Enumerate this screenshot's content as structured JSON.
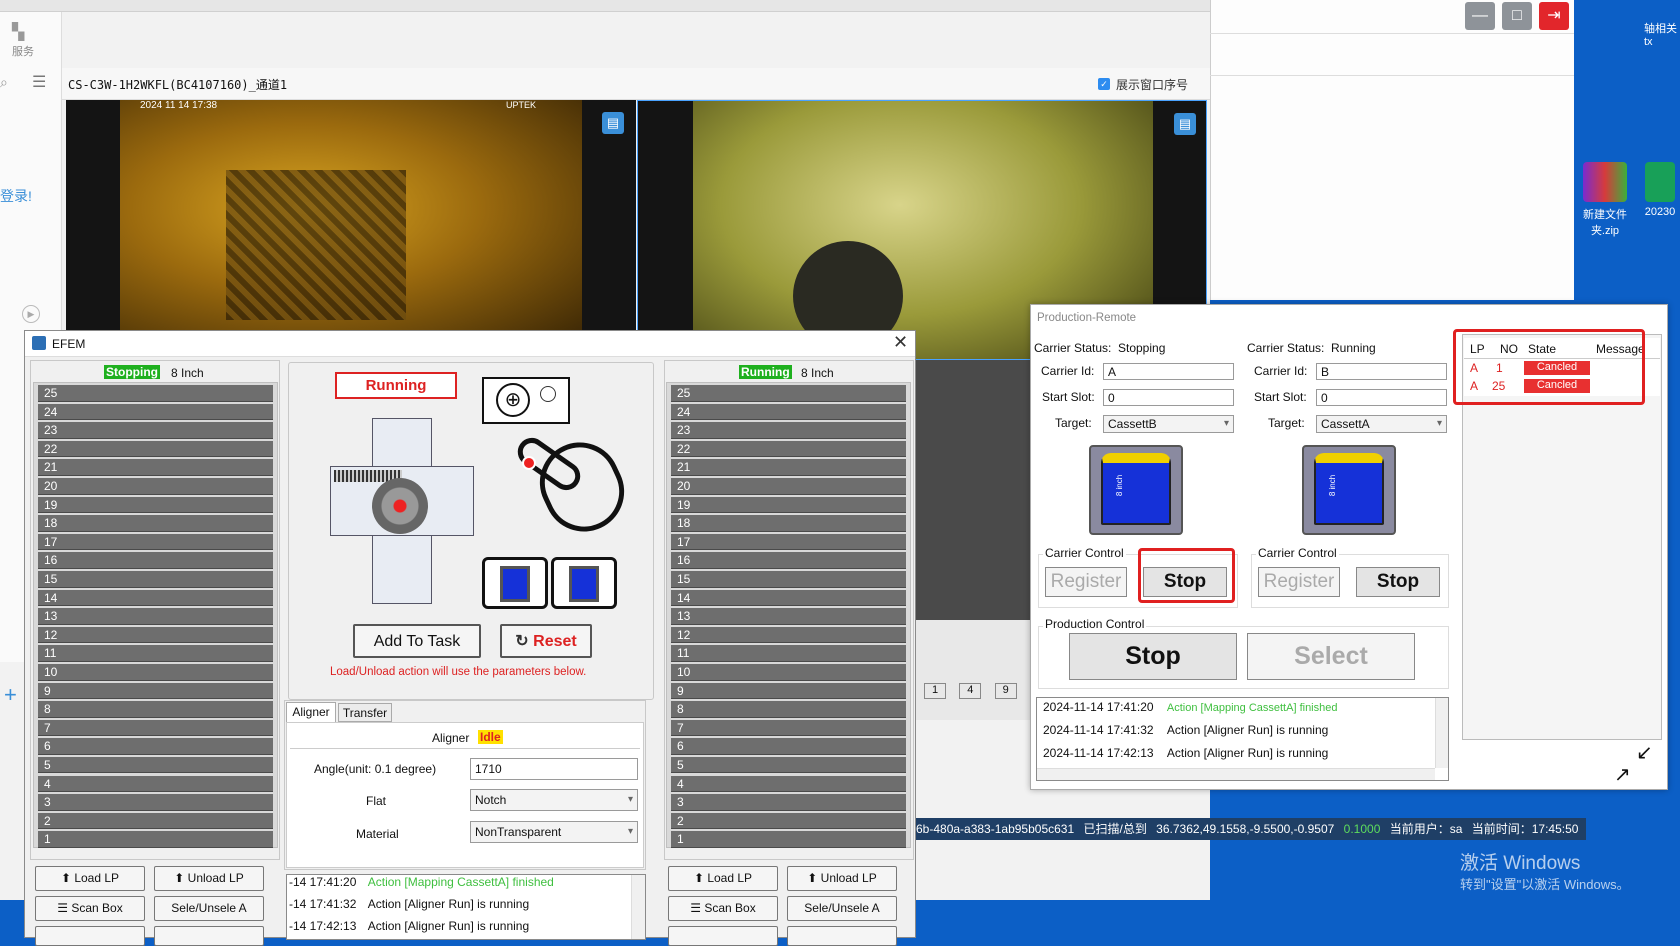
{
  "viewer": {
    "sidebar_label": "服务",
    "channel_title": "CS-C3W-1H2WKFL(BC4107160)_通道1",
    "show_index_label": "展示窗口序号",
    "cam1_timestamp": "2024 11 14 17:38",
    "cam1_brand": "UPTEK",
    "login_partial": "登录!",
    "pager": [
      "1",
      "4",
      "9"
    ]
  },
  "status_bar": {
    "id": "6b-480a-a383-1ab95b05c631",
    "scan": "已扫描/总到",
    "coords": "36.7362,49.1558,-9.5500,-0.9507",
    "value": "0.1000",
    "user": "当前用户：sa",
    "time": "当前时间：17:45:50"
  },
  "desktop": {
    "top_right_label": "轴相关tx",
    "icons": [
      {
        "label": "新建文件夹.zip"
      },
      {
        "label": "20230"
      }
    ],
    "activate_title": "激活 Windows",
    "activate_sub": "转到\"设置\"以激活 Windows。"
  },
  "efem": {
    "title": "EFEM",
    "left": {
      "state": "Stopping",
      "size": "8 Inch"
    },
    "right": {
      "state": "Running",
      "size": "8 Inch"
    },
    "slots": [
      "25",
      "24",
      "23",
      "22",
      "21",
      "20",
      "19",
      "18",
      "17",
      "16",
      "15",
      "14",
      "13",
      "12",
      "11",
      "10",
      "9",
      "8",
      "7",
      "6",
      "5",
      "4",
      "3",
      "2",
      "1"
    ],
    "center": {
      "state": "Running",
      "add_task": "Add To Task",
      "reset": "Reset",
      "note": "Load/Unload action will use the parameters below."
    },
    "tabs": [
      "Aligner",
      "Transfer"
    ],
    "aligner": {
      "label": "Aligner",
      "state": "Idle",
      "angle_label": "Angle(unit:  0.1 degree)",
      "angle_value": "1710",
      "flat_label": "Flat",
      "flat_value": "Notch",
      "material_label": "Material",
      "material_value": "NonTransparent"
    },
    "buttons": {
      "load": "Load LP",
      "unload": "Unload LP",
      "scan": "Scan Box",
      "sele": "Sele/Unsele A"
    },
    "log": [
      {
        "time": "-14 17:41:20",
        "msg": "Action [Mapping CassettA] finished",
        "color": "#3fbf3f"
      },
      {
        "time": "-14 17:41:32",
        "msg": "Action [Aligner Run] is running",
        "color": "#111111"
      },
      {
        "time": "-14 17:42:13",
        "msg": "Action [Aligner Run] is running",
        "color": "#111111"
      }
    ]
  },
  "prod": {
    "title": "Production-Remote",
    "status_label": "Carrier Status:",
    "id_label": "Carrier Id:",
    "slot_label": "Start Slot:",
    "target_label": "Target:",
    "a": {
      "status": "Stopping",
      "id": "A",
      "slot": "0",
      "target": "CassettB"
    },
    "b": {
      "status": "Running",
      "id": "B",
      "slot": "0",
      "target": "CassettA"
    },
    "carrier_control": "Carrier Control",
    "register": "Register",
    "stop": "Stop",
    "production_control": "Production Control",
    "select": "Select",
    "cassette_label": "8 inch",
    "table": {
      "headers": [
        "LP",
        "NO",
        "State",
        "Message"
      ],
      "rows": [
        {
          "lp": "A",
          "no": "1",
          "state": "Cancled",
          "message": ""
        },
        {
          "lp": "A",
          "no": "25",
          "state": "Cancled",
          "message": ""
        }
      ]
    },
    "log": [
      {
        "time": "2024-11-14 17:41:20",
        "msg": "Action [Mapping CassettA] finished",
        "color": "#3fbf3f"
      },
      {
        "time": "2024-11-14 17:41:32",
        "msg": "Action [Aligner Run] is running",
        "color": "#111111"
      },
      {
        "time": "2024-11-14 17:42:13",
        "msg": "Action [Aligner Run] is running",
        "color": "#111111"
      }
    ]
  }
}
